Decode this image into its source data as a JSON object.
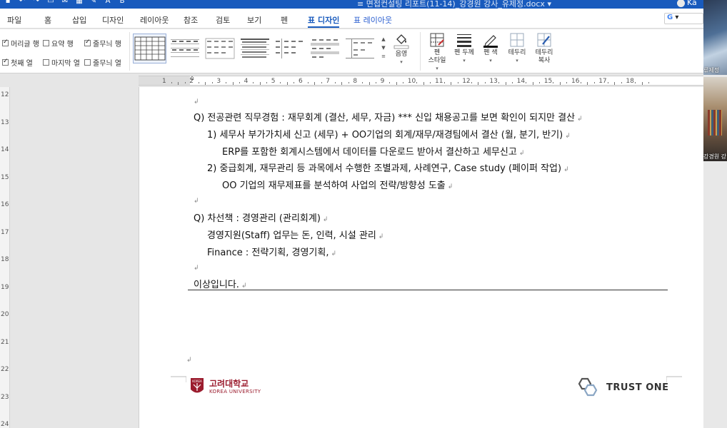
{
  "titlebar": {
    "doc_title": "면접컨설팅 리포트(11-14)_강경원 강사_유제정.docx",
    "user_initials": "Ka"
  },
  "menu": {
    "tabs": [
      {
        "label": "파일"
      },
      {
        "label": "홈"
      },
      {
        "label": "삽입"
      },
      {
        "label": "디자인"
      },
      {
        "label": "레이아웃"
      },
      {
        "label": "참조"
      },
      {
        "label": "검토"
      },
      {
        "label": "보기"
      },
      {
        "label": "펜"
      },
      {
        "label": "표 디자인"
      },
      {
        "label": "표 레이아웃"
      }
    ],
    "search_glyph": "G"
  },
  "ribbon": {
    "options": {
      "header_row": "머리글 행",
      "total_row": "요약 행",
      "banded_rows": "줄무늬 행",
      "first_column": "첫째 열",
      "last_column": "마지막 열",
      "banded_columns": "줄무늬 열"
    },
    "shading": "음영",
    "pen_style": "펜\n스타일",
    "pen_weight": "펜 두께",
    "pen_color": "펜 색",
    "borders": "테두리",
    "border_painter": "테두리\n복사"
  },
  "ruler": {
    "numbers": [
      "1",
      "2",
      "3",
      "4",
      "5",
      "6",
      "7",
      "8",
      "9",
      "10",
      "11",
      "12",
      "13",
      "14",
      "15",
      "16",
      "17",
      "18"
    ],
    "vertical_numbers": [
      "12",
      "13",
      "14",
      "15",
      "16",
      "17",
      "18",
      "19",
      "20",
      "21",
      "22",
      "23",
      "24"
    ]
  },
  "document": {
    "lines": [
      "Q)  전공관련 직무경험 : 재무회계 (결산, 세무, 자금) *** 신입 채용공고를 보면 확인이 되지만 결산",
      "1)  세무사 부가가치세 신고 (세무)   + OO기업의 회계/재무/재경팀에서 결산 (월, 분기, 반기)",
      "ERP를 포함한 회계시스템에서 데이터를 다운로드 받아서 결산하고 세무신고",
      "2)  중급회계, 재무관리 등 과목에서 수행한 조별과제, 사례연구, Case study (페이퍼 작업)",
      "OO 기업의 재무제표를 분석하여 사업의 전략/방향성 도출",
      "Q)  차선책 : 경영관리 (관리회계)",
      "경영지원(Staff)  업무는 돈, 인력, 시설 관리",
      "Finance : 전략기획, 경영기획,",
      "이상입니다."
    ],
    "paragraph_mark": "↲"
  },
  "footer": {
    "university_ko": "고려대학교",
    "university_en": "KOREA UNIVERSITY",
    "seal_text": "KOREA",
    "company": "TRUST ONE"
  },
  "video": {
    "participant_1": "류제정",
    "participant_2": "강경원 강"
  },
  "colors": {
    "word_blue": "#185abd",
    "university_red": "#9b1c2e"
  }
}
